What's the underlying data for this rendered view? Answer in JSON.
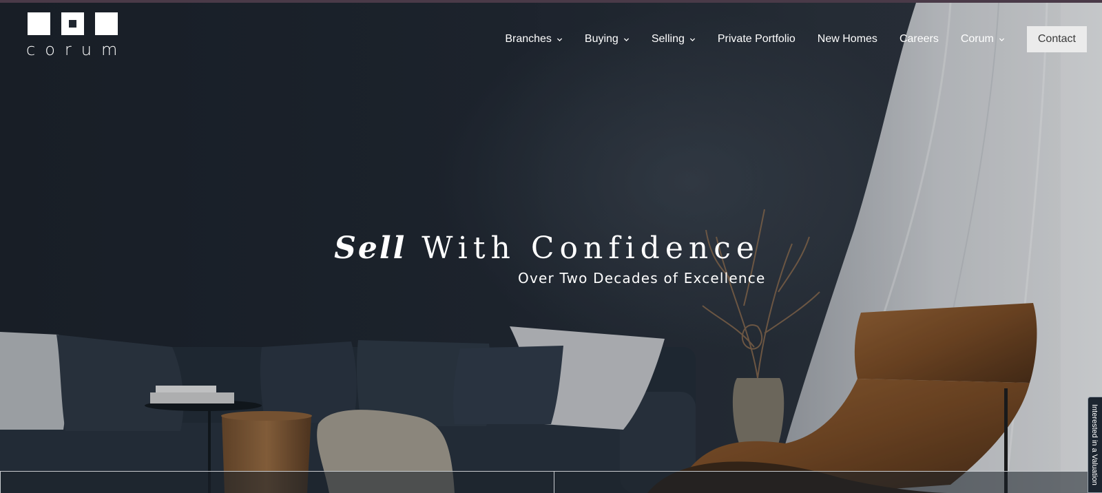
{
  "brand": {
    "name": "corum"
  },
  "nav": {
    "items": [
      {
        "label": "Branches",
        "has_dropdown": true
      },
      {
        "label": "Buying",
        "has_dropdown": true
      },
      {
        "label": "Selling",
        "has_dropdown": true
      },
      {
        "label": "Private Portfolio",
        "has_dropdown": false
      },
      {
        "label": "New Homes",
        "has_dropdown": false
      },
      {
        "label": "Careers",
        "has_dropdown": false
      },
      {
        "label": "Corum",
        "has_dropdown": true
      }
    ],
    "contact_label": "Contact"
  },
  "hero": {
    "headline_emphasis": "Sell",
    "headline_rest": "With Confidence",
    "subheadline": "Over Two Decades of Excellence"
  },
  "side_tab": {
    "label": "Interested in a Valuation"
  },
  "colors": {
    "background": "#1f262f",
    "nav_text": "#ffffff",
    "contact_button_bg": "#ebebeb",
    "top_accent": "#4a3a48"
  },
  "icons": {
    "dropdown": "chevron-down-icon"
  }
}
